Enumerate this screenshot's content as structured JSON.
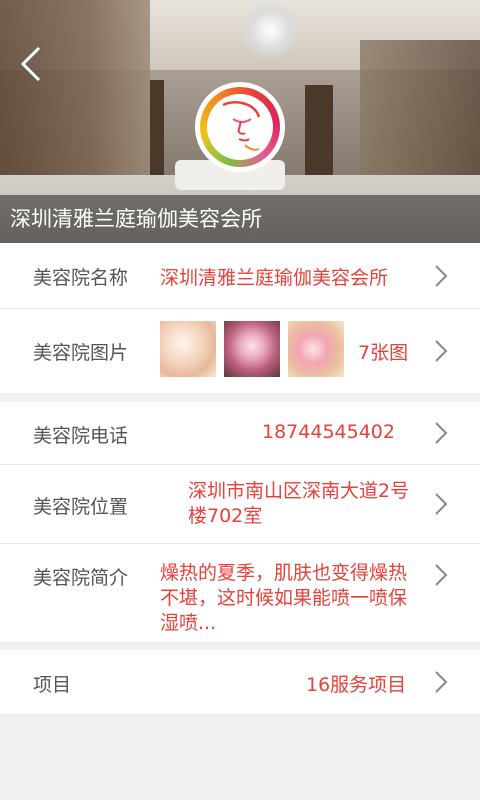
{
  "header": {
    "title": "深圳清雅兰庭瑜伽美容会所",
    "back_icon": "chevron-left-icon",
    "logo": "face-logo"
  },
  "details": {
    "name": {
      "label": "美容院名称",
      "value": "深圳清雅兰庭瑜伽美容会所"
    },
    "photos": {
      "label": "美容院图片",
      "count_text": "7张图",
      "thumbnails": [
        "blossom-photo-1",
        "blossom-photo-2",
        "blossom-photo-3"
      ]
    },
    "phone": {
      "label": "美容院电话",
      "value": "18744545402"
    },
    "location": {
      "label": "美容院位置",
      "value": "深圳市南山区深南大道2号楼702室"
    },
    "intro": {
      "label": "美容院简介",
      "value": "燥热的夏季，肌肤也变得燥热不堪，这时候如果能喷一喷保湿喷..."
    },
    "services": {
      "label": "项目",
      "value": "16服务项目"
    }
  },
  "colors": {
    "accent": "#e8413b",
    "label": "#555555",
    "background": "#f0f0f0"
  }
}
